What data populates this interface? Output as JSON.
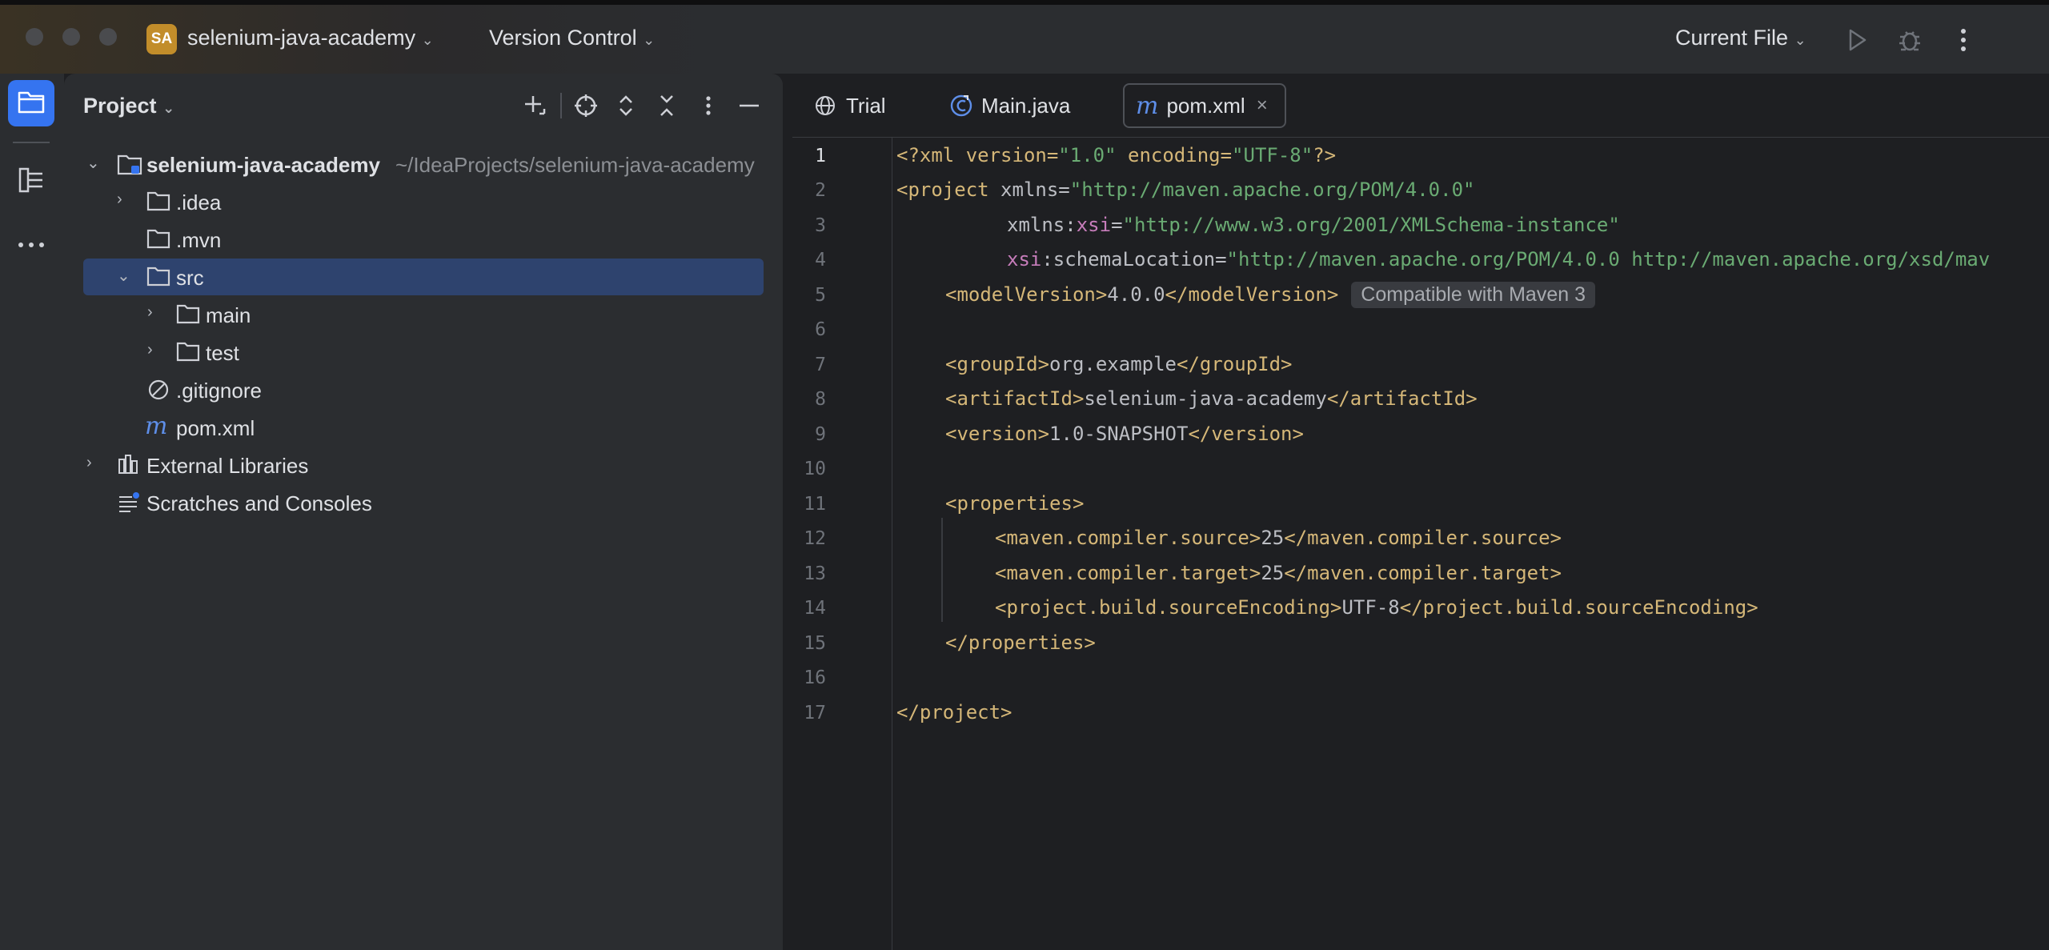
{
  "titlebar": {
    "project_badge": "SA",
    "project_name": "selenium-java-academy",
    "vcs_label": "Version Control",
    "run_config": "Current File"
  },
  "project_panel": {
    "title": "Project",
    "tree": [
      {
        "label": "selenium-java-academy",
        "path": "~/IdeaProjects/selenium-java-academy"
      },
      {
        "label": ".idea"
      },
      {
        "label": ".mvn"
      },
      {
        "label": "src"
      },
      {
        "label": "main"
      },
      {
        "label": "test"
      },
      {
        "label": ".gitignore"
      },
      {
        "label": "pom.xml"
      },
      {
        "label": "External Libraries"
      },
      {
        "label": "Scratches and Consoles"
      }
    ]
  },
  "editor": {
    "tabs": [
      {
        "label": "Trial"
      },
      {
        "label": "Main.java"
      },
      {
        "label": "pom.xml"
      }
    ],
    "line_numbers": [
      "1",
      "2",
      "3",
      "4",
      "5",
      "6",
      "7",
      "8",
      "9",
      "10",
      "11",
      "12",
      "13",
      "14",
      "15",
      "16",
      "17"
    ],
    "code": {
      "l1_open": "<?xml version=",
      "l1_v": "\"1.0\"",
      "l1_enc": " encoding=",
      "l1_encv": "\"UTF-8\"",
      "l1_close": "?>",
      "l2_tag": "<project",
      "l2_attr": " xmlns=",
      "l2_val": "\"http://maven.apache.org/POM/4.0.0\"",
      "l3_attr": "xmlns:",
      "l3_ns": "xsi",
      "l3_eq": "=",
      "l3_val": "\"http://www.w3.org/2001/XMLSchema-instance\"",
      "l4_ns": "xsi",
      "l4_attr": ":schemaLocation=",
      "l4_val": "\"http://maven.apache.org/POM/4.0.0 http://maven.apache.org/xsd/mav",
      "l5_open": "<modelVersion>",
      "l5_text": "4.0.0",
      "l5_close": "</modelVersion>",
      "l5_hint": "Compatible with Maven 3",
      "l7_open": "<groupId>",
      "l7_text": "org.example",
      "l7_close": "</groupId>",
      "l8_open": "<artifactId>",
      "l8_text": "selenium-java-academy",
      "l8_close": "</artifactId>",
      "l9_open": "<version>",
      "l9_text": "1.0-SNAPSHOT",
      "l9_close": "</version>",
      "l11": "<properties>",
      "l12_open": "<maven.compiler.source>",
      "l12_text": "25",
      "l12_close": "</maven.compiler.source>",
      "l13_open": "<maven.compiler.target>",
      "l13_text": "25",
      "l13_close": "</maven.compiler.target>",
      "l14_open": "<project.build.sourceEncoding>",
      "l14_text": "UTF-8",
      "l14_close": "</project.build.sourceEncoding>",
      "l15": "</properties>",
      "l17": "</project>"
    }
  },
  "icons": [
    "folder-icon",
    "structure-icon",
    "more-icon",
    "add-icon",
    "locate-icon",
    "expand-all-icon",
    "collapse-all-icon",
    "options-icon",
    "hide-icon",
    "run-icon",
    "debug-icon",
    "globe-icon",
    "java-class-icon",
    "maven-icon",
    "close-icon"
  ]
}
